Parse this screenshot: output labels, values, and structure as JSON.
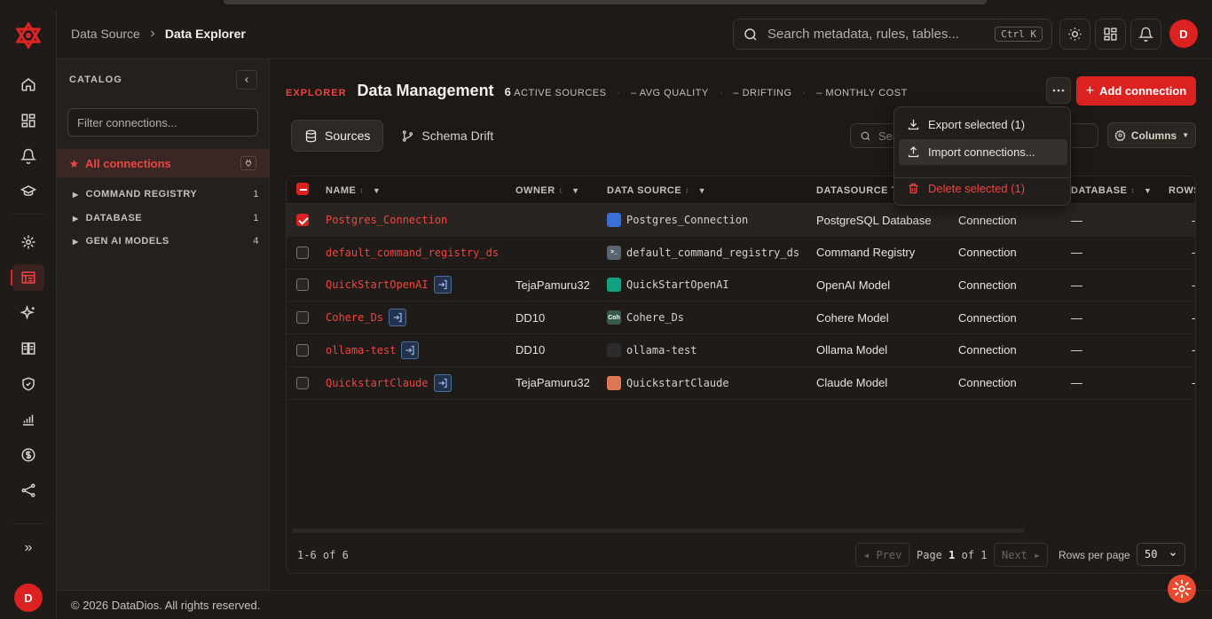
{
  "header": {
    "breadcrumb_parent": "Data Source",
    "breadcrumb_current": "Data Explorer",
    "search_placeholder": "Search metadata, rules, tables...",
    "search_shortcut": "Ctrl K",
    "avatar_initial": "D"
  },
  "rail": {
    "avatar_initial": "D",
    "expand_label": "»"
  },
  "catalog": {
    "title": "CATALOG",
    "filter_placeholder": "Filter connections...",
    "all_connections": "All connections",
    "groups": [
      {
        "label": "COMMAND REGISTRY",
        "count": "1"
      },
      {
        "label": "DATABASE",
        "count": "1"
      },
      {
        "label": "GEN AI MODELS",
        "count": "4"
      }
    ]
  },
  "main": {
    "explorer_tag": "EXPLORER",
    "title": "Data Management",
    "active_sources_count": "6",
    "active_sources_label": "ACTIVE SOURCES",
    "avg_quality": "AVG QUALITY",
    "drifting": "DRIFTING",
    "monthly_cost": "MONTHLY COST",
    "stat_placeholder": "–",
    "add_connection": "Add connection",
    "tabs": [
      {
        "label": "Sources"
      },
      {
        "label": "Schema Drift"
      }
    ],
    "table_search_placeholder": "Sea",
    "columns_button": "Columns"
  },
  "menu": {
    "export": "Export selected (1)",
    "import": "Import connections...",
    "delete": "Delete selected (1)"
  },
  "table": {
    "headers": {
      "name": "NAME",
      "owner": "OWNER",
      "data_source": "DATA SOURCE",
      "datasource_type": "DATASOURCE T",
      "database": "DATABASE",
      "rows": "ROWS"
    },
    "rows": [
      {
        "name": "Postgres_Connection",
        "owner": "",
        "ds": "Postgres_Connection",
        "type": "PostgreSQL Database",
        "kind": "Connection",
        "db": "—",
        "rows": "-",
        "selected": true,
        "login": false,
        "ico_color": "#3b6fd8",
        "ico_text": ""
      },
      {
        "name": "default_command_registry_ds",
        "owner": "",
        "ds": "default_command_registry_ds",
        "type": "Command Registry",
        "kind": "Connection",
        "db": "—",
        "rows": "-",
        "selected": false,
        "login": false,
        "ico_color": "#5b6472",
        "ico_text": ">_"
      },
      {
        "name": "QuickStartOpenAI",
        "owner": "TejaPamuru32",
        "ds": "QuickStartOpenAI",
        "type": "OpenAI Model",
        "kind": "Connection",
        "db": "—",
        "rows": "-",
        "selected": false,
        "login": true,
        "ico_color": "#10a37f",
        "ico_text": ""
      },
      {
        "name": "Cohere_Ds",
        "owner": "DD10",
        "ds": "Cohere_Ds",
        "type": "Cohere Model",
        "kind": "Connection",
        "db": "—",
        "rows": "-",
        "selected": false,
        "login": true,
        "ico_color": "#39594d",
        "ico_text": "Coh"
      },
      {
        "name": "ollama-test",
        "owner": "DD10",
        "ds": "ollama-test",
        "type": "Ollama Model",
        "kind": "Connection",
        "db": "—",
        "rows": "-",
        "selected": false,
        "login": true,
        "ico_color": "#2b2b2b",
        "ico_text": ""
      },
      {
        "name": "QuickstartClaude",
        "owner": "TejaPamuru32",
        "ds": "QuickstartClaude",
        "type": "Claude Model",
        "kind": "Connection",
        "db": "—",
        "rows": "-",
        "selected": false,
        "login": true,
        "ico_color": "#d97757",
        "ico_text": ""
      }
    ],
    "range": "1-6 of 6",
    "prev": "◂ Prev",
    "next": "Next ▸",
    "page_label": "Page",
    "page_current": "1",
    "page_of": "of 1",
    "rows_per_page_label": "Rows per page",
    "rows_per_page": "50"
  },
  "footer": {
    "copyright": "© 2026 DataDios. All rights reserved."
  }
}
